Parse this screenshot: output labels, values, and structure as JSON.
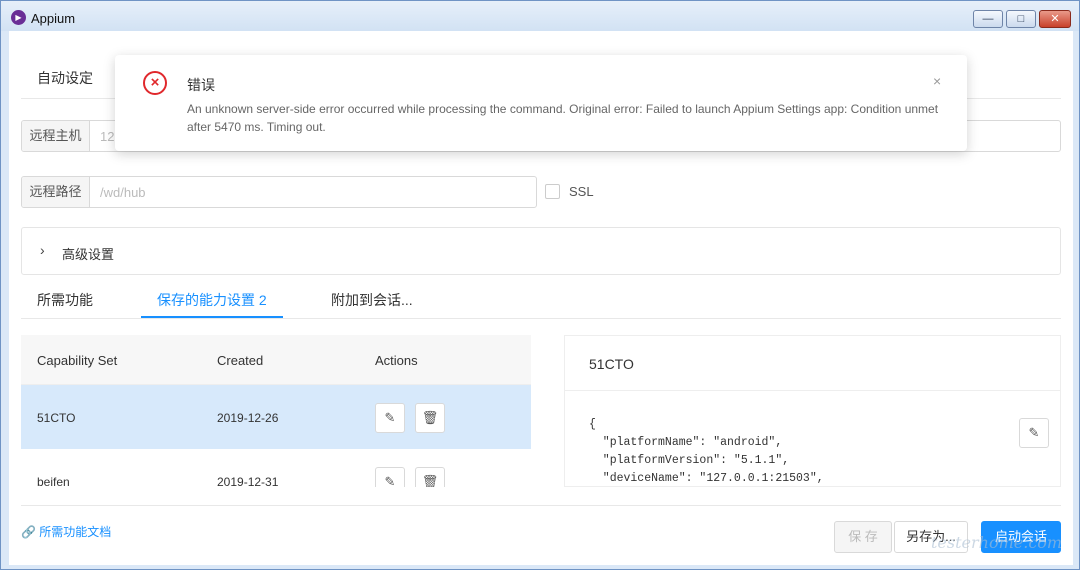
{
  "window": {
    "title": "Appium",
    "app_icon": "appium-logo-icon",
    "minimize_glyph": "—",
    "maximize_glyph": "□",
    "close_glyph": "✕"
  },
  "server": {
    "settings_tab": "自动设定",
    "host_label": "远程主机",
    "host_value": "12",
    "path_label": "远程路径",
    "path_placeholder": "/wd/hub",
    "ssl_label": "SSL",
    "advanced_label": "高级设置"
  },
  "tabs": {
    "items": [
      "所需功能",
      "保存的能力设置 2",
      "附加到会话..."
    ],
    "active_index": 1
  },
  "table": {
    "headers": [
      "Capability Set",
      "Created",
      "Actions"
    ],
    "rows": [
      {
        "name": "51CTO",
        "created": "2019-12-26",
        "selected": true
      },
      {
        "name": "beifen",
        "created": "2019-12-31",
        "selected": false
      }
    ],
    "edit_icon": "pencil-icon",
    "delete_icon": "trash-icon"
  },
  "detail": {
    "title": "51CTO",
    "json_lines": [
      "{",
      "  \"platformName\": \"android\",",
      "  \"platformVersion\": \"5.1.1\",",
      "  \"deviceName\": \"127.0.0.1:21503\","
    ]
  },
  "footer": {
    "doc_link": "所需功能文档",
    "save_label": "保 存",
    "save_as_label": "另存为...",
    "start_label": "启动会话"
  },
  "notification": {
    "title": "错误",
    "message": "An unknown server-side error occurred while processing the command. Original error: Failed to launch Appium Settings app: Condition unmet after 5470 ms. Timing out.",
    "close_glyph": "×"
  },
  "watermark": "testerhome.com",
  "colors": {
    "accent": "#1890ff",
    "error": "#e0282c",
    "selected_row": "#d7e9fb"
  }
}
